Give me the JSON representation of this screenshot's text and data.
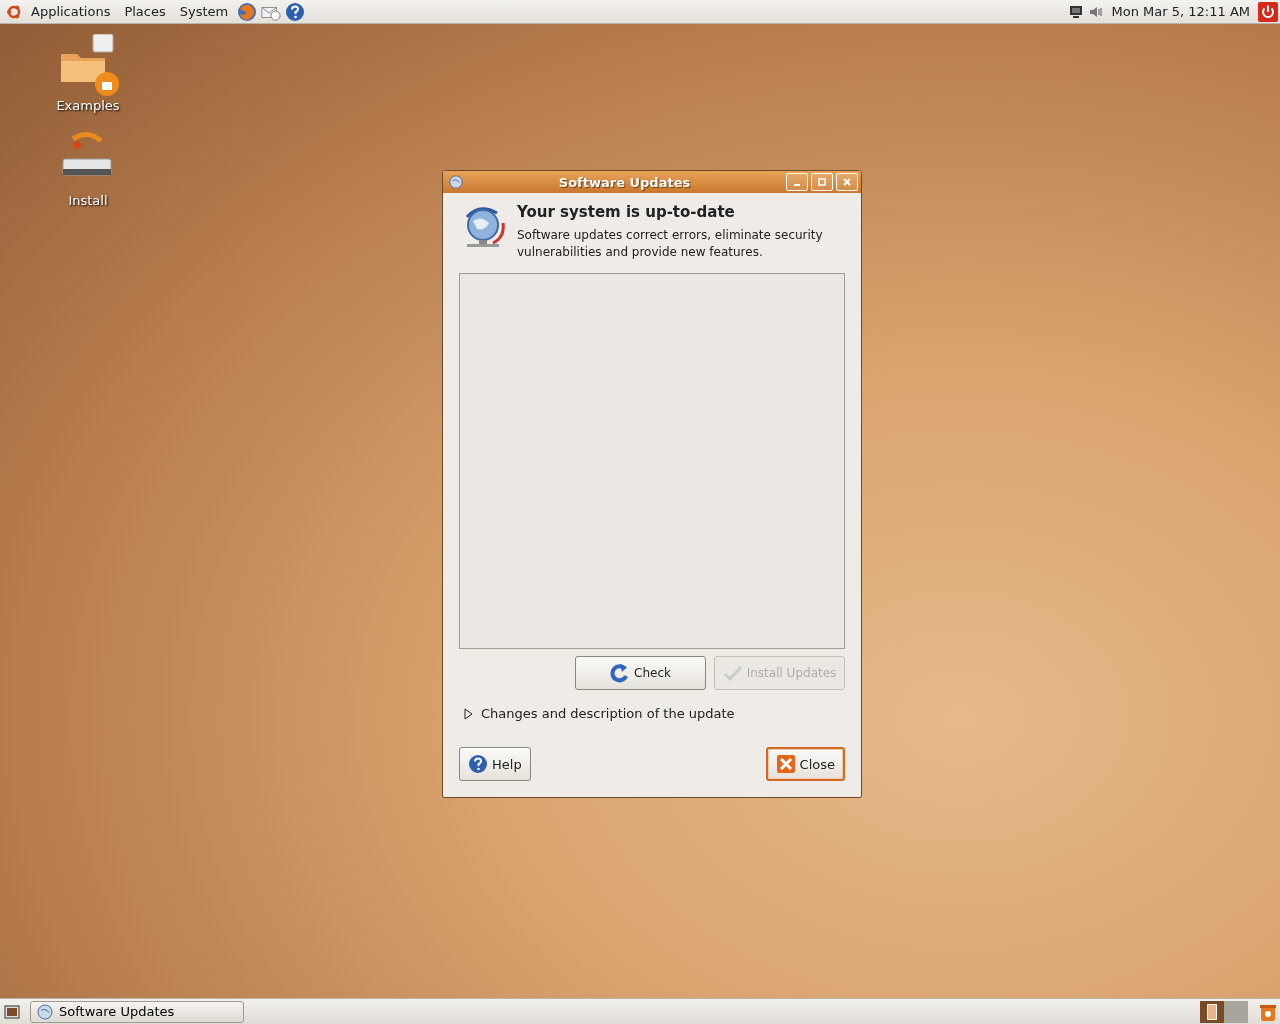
{
  "top_panel": {
    "menus": [
      {
        "label": "Applications"
      },
      {
        "label": "Places"
      },
      {
        "label": "System"
      }
    ],
    "clock": "Mon Mar  5, 12:11 AM"
  },
  "desktop_icons": [
    {
      "label": "Examples",
      "kind": "folder"
    },
    {
      "label": "Install",
      "kind": "installer"
    }
  ],
  "window": {
    "title": "Software Updates",
    "heading": "Your system is up-to-date",
    "description": "Software updates correct errors, eliminate security vulnerabilities and provide new features.",
    "buttons": [
      {
        "label": "Check",
        "kind": "check",
        "disabled": false
      },
      {
        "label": "Install Updates",
        "kind": "install",
        "disabled": true
      }
    ],
    "expander": {
      "label": "Changes and description of the update",
      "expanded": false
    },
    "footer_buttons": [
      {
        "label": "Help",
        "kind": "help",
        "default": false
      },
      {
        "label": "Close",
        "kind": "close",
        "default": true
      }
    ]
  },
  "bottom_panel": {
    "tasks": [
      {
        "label": "Software Updates",
        "selected": false
      }
    ],
    "workspaces": [
      {
        "selected": true
      },
      {
        "selected": false
      }
    ]
  }
}
